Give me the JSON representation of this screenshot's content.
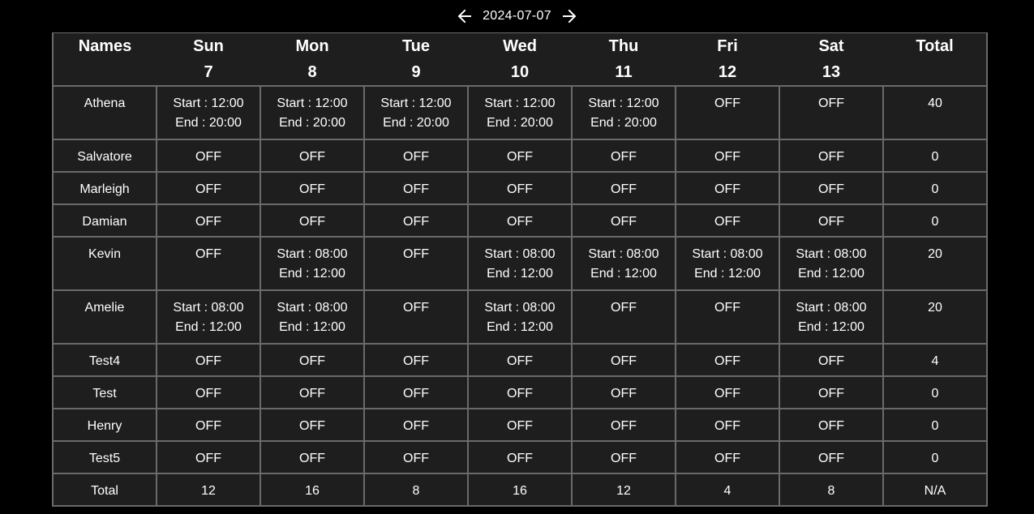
{
  "nav": {
    "date": "2024-07-07",
    "prev_icon": "arrow-left-icon",
    "next_icon": "arrow-right-icon"
  },
  "header": {
    "names_label": "Names",
    "total_label": "Total",
    "days": [
      {
        "name": "Sun",
        "num": "7"
      },
      {
        "name": "Mon",
        "num": "8"
      },
      {
        "name": "Tue",
        "num": "9"
      },
      {
        "name": "Wed",
        "num": "10"
      },
      {
        "name": "Thu",
        "num": "11"
      },
      {
        "name": "Fri",
        "num": "12"
      },
      {
        "name": "Sat",
        "num": "13"
      }
    ]
  },
  "rows": [
    {
      "name": "Athena",
      "cells": [
        "Start : 12:00|End : 20:00",
        "Start : 12:00|End : 20:00",
        "Start : 12:00|End : 20:00",
        "Start : 12:00|End : 20:00",
        "Start : 12:00|End : 20:00",
        "OFF",
        "OFF"
      ],
      "total": "40"
    },
    {
      "name": "Salvatore",
      "cells": [
        "OFF",
        "OFF",
        "OFF",
        "OFF",
        "OFF",
        "OFF",
        "OFF"
      ],
      "total": "0"
    },
    {
      "name": "Marleigh",
      "cells": [
        "OFF",
        "OFF",
        "OFF",
        "OFF",
        "OFF",
        "OFF",
        "OFF"
      ],
      "total": "0"
    },
    {
      "name": "Damian",
      "cells": [
        "OFF",
        "OFF",
        "OFF",
        "OFF",
        "OFF",
        "OFF",
        "OFF"
      ],
      "total": "0"
    },
    {
      "name": "Kevin",
      "cells": [
        "OFF",
        "Start : 08:00|End : 12:00",
        "OFF",
        "Start : 08:00|End : 12:00",
        "Start : 08:00|End : 12:00",
        "Start : 08:00|End : 12:00",
        "Start : 08:00|End : 12:00"
      ],
      "total": "20"
    },
    {
      "name": "Amelie",
      "cells": [
        "Start : 08:00|End : 12:00",
        "Start : 08:00|End : 12:00",
        "OFF",
        "Start : 08:00|End : 12:00",
        "OFF",
        "OFF",
        "Start : 08:00|End : 12:00"
      ],
      "total": "20"
    },
    {
      "name": "Test4",
      "cells": [
        "OFF",
        "OFF",
        "OFF",
        "OFF",
        "OFF",
        "OFF",
        "OFF"
      ],
      "total": "4"
    },
    {
      "name": "Test",
      "cells": [
        "OFF",
        "OFF",
        "OFF",
        "OFF",
        "OFF",
        "OFF",
        "OFF"
      ],
      "total": "0"
    },
    {
      "name": "Henry",
      "cells": [
        "OFF",
        "OFF",
        "OFF",
        "OFF",
        "OFF",
        "OFF",
        "OFF"
      ],
      "total": "0"
    },
    {
      "name": "Test5",
      "cells": [
        "OFF",
        "OFF",
        "OFF",
        "OFF",
        "OFF",
        "OFF",
        "OFF"
      ],
      "total": "0"
    }
  ],
  "totals_row": {
    "label": "Total",
    "values": [
      "12",
      "16",
      "8",
      "16",
      "12",
      "4",
      "8"
    ],
    "grand_total": "N/A"
  }
}
